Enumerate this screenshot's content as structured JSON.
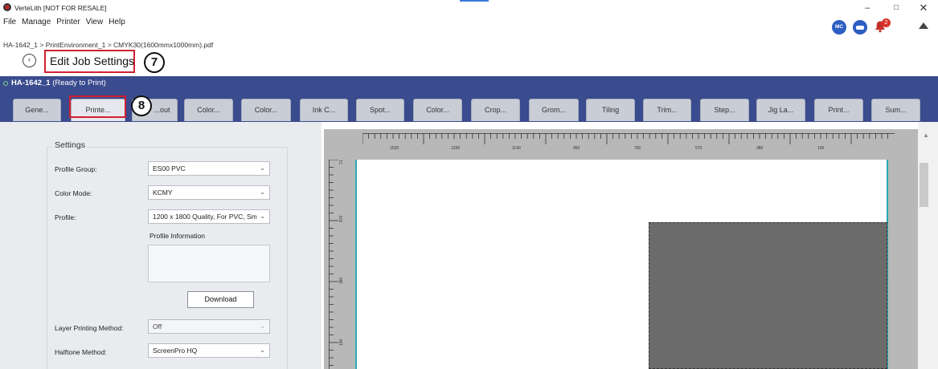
{
  "window": {
    "title": "VerteLith [NOT FOR RESALE]",
    "minimize_glyph": "–",
    "maximize_glyph": "□",
    "close_glyph": "✕"
  },
  "menu": [
    "File",
    "Manage",
    "Printer",
    "View",
    "Help"
  ],
  "header_icons": {
    "user_badge": "MC",
    "notification_count": "2"
  },
  "breadcrumb": "HA-1642_1 > PrintEnvironment_1 > CMYK30(1600mmx1000mm).pdf",
  "page_title": "Edit Job Settings",
  "callouts": {
    "c7": "7",
    "c8": "8"
  },
  "job": {
    "name": "HA-1642_1",
    "status": "(Ready to Print)"
  },
  "tabs": [
    "Gene...",
    "Printe...",
    "...out",
    "Color...",
    "Color...",
    "Ink C...",
    "Spot...",
    "Color...",
    "Crop...",
    "Grom...",
    "Tiling",
    "Trim...",
    "Step...",
    "Jig La...",
    "Print...",
    "Sum..."
  ],
  "active_tab_index": 1,
  "settings": {
    "section_title": "Settings",
    "profile_group": {
      "label": "Profile Group:",
      "value": "ES00 PVC"
    },
    "color_mode": {
      "label": "Color Mode:",
      "value": "KCMY"
    },
    "profile": {
      "label": "Profile:",
      "value": "1200 x 1800 Quality, For PVC, Sm"
    },
    "profile_information_label": "Profile Information",
    "download_label": "Download",
    "layer_printing": {
      "label": "Layer Printing Method:",
      "value": "Off"
    },
    "halftone": {
      "label": "Halftone Method:",
      "value": "ScreenPro HQ"
    }
  },
  "preview": {
    "horizontal_ruler_labels": [
      "1520",
      "1330",
      "1140",
      "950",
      "760",
      "570",
      "380",
      "190"
    ],
    "vertical_ruler_labels": [
      "71",
      "570",
      "380",
      "190"
    ]
  },
  "colors": {
    "jobbar_bg": "#3a4b8e",
    "highlight_red": "#d1202f",
    "page_edge_teal": "#2aa9b5",
    "print_block": "#6b6b6b"
  }
}
